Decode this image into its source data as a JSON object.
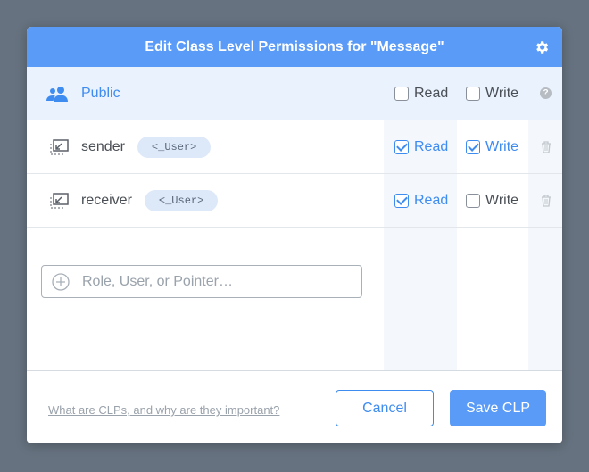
{
  "header": {
    "title": "Edit Class Level Permissions for \"Message\""
  },
  "rows": [
    {
      "name": "Public",
      "read_label": "Read",
      "write_label": "Write",
      "read_checked": false,
      "write_checked": false
    },
    {
      "name": "sender",
      "tag": "<_User>",
      "read_label": "Read",
      "write_label": "Write",
      "read_checked": true,
      "write_checked": true
    },
    {
      "name": "receiver",
      "tag": "<_User>",
      "read_label": "Read",
      "write_label": "Write",
      "read_checked": true,
      "write_checked": false
    }
  ],
  "add_input": {
    "placeholder": "Role, User, or Pointer…",
    "value": ""
  },
  "footer": {
    "help_link": "What are CLPs, and why are they important?",
    "cancel_label": "Cancel",
    "save_label": "Save CLP"
  },
  "colors": {
    "accent": "#5a9bf7",
    "link": "#3f8cf0",
    "backdrop": "#66727f"
  },
  "icons": [
    "gear-icon",
    "users-icon",
    "pointer-icon",
    "trash-icon",
    "help-icon",
    "plus-icon"
  ]
}
